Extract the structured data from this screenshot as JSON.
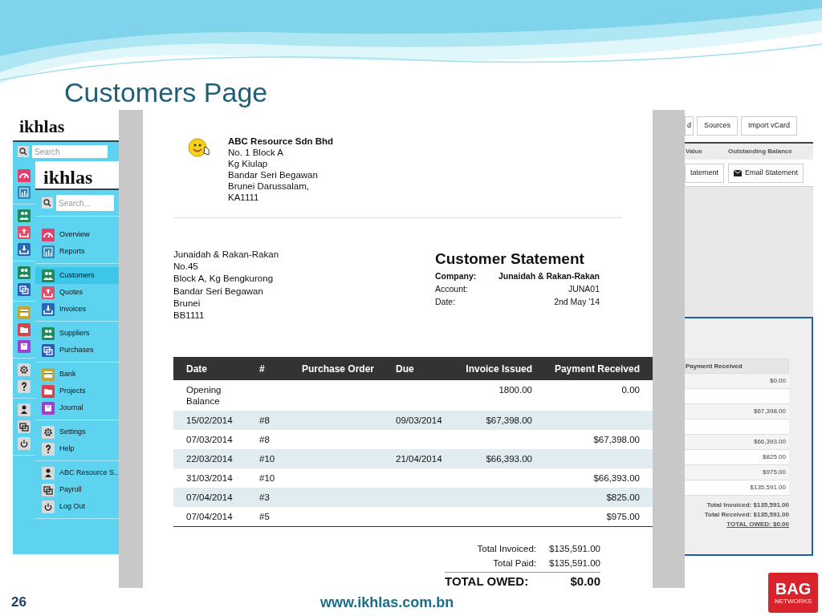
{
  "slide": {
    "title": "Customers Page",
    "page_number": "26",
    "url": "www.ikhlas.com.bn",
    "logo": {
      "text": "BAG",
      "subtext": "NETWORKS"
    }
  },
  "back_app": {
    "logo": "ikhlas",
    "search_placeholder": "Search",
    "icon_groups": [
      [
        {
          "kind": "gauge",
          "color": "#e23f6b"
        },
        {
          "kind": "chart",
          "color": "#2d86b5"
        }
      ],
      [
        {
          "kind": "people",
          "color": "#1f8a5a"
        },
        {
          "kind": "upload",
          "color": "#e0506a"
        },
        {
          "kind": "download",
          "color": "#2a67b5"
        }
      ],
      [
        {
          "kind": "people",
          "color": "#1f8a5a"
        },
        {
          "kind": "cards",
          "color": "#2a5db5"
        }
      ],
      [
        {
          "kind": "card",
          "color": "#c7a533"
        },
        {
          "kind": "folder",
          "color": "#d9434f"
        },
        {
          "kind": "book",
          "color": "#a23fd0"
        }
      ],
      [
        {
          "kind": "gear",
          "color": "#d9d9d9"
        },
        {
          "kind": "question",
          "color": "#d9d9d9"
        }
      ],
      [
        {
          "kind": "person",
          "color": "#d9d9d9"
        },
        {
          "kind": "cards",
          "color": "#d9d9d9"
        },
        {
          "kind": "power",
          "color": "#d9d9d9"
        }
      ]
    ]
  },
  "front_app": {
    "logo": "ikhlas",
    "search_placeholder": "Search...",
    "nav_groups": [
      [
        {
          "label": "Overview",
          "kind": "gauge",
          "color": "#e23f6b",
          "selected": false
        },
        {
          "label": "Reports",
          "kind": "chart",
          "color": "#2d86b5",
          "selected": false
        }
      ],
      [
        {
          "label": "Customers",
          "kind": "people",
          "color": "#1f8a5a",
          "selected": true
        },
        {
          "label": "Quotes",
          "kind": "upload",
          "color": "#e0506a",
          "selected": false
        },
        {
          "label": "Invoices",
          "kind": "download",
          "color": "#2a67b5",
          "selected": false
        }
      ],
      [
        {
          "label": "Suppliers",
          "kind": "people",
          "color": "#1f8a5a",
          "selected": false
        },
        {
          "label": "Purchases",
          "kind": "cards",
          "color": "#2a5db5",
          "selected": false
        }
      ],
      [
        {
          "label": "Bank",
          "kind": "card",
          "color": "#c7a533",
          "selected": false
        },
        {
          "label": "Projects",
          "kind": "folder",
          "color": "#d9434f",
          "selected": false
        },
        {
          "label": "Journal",
          "kind": "book",
          "color": "#a23fd0",
          "selected": false
        }
      ],
      [
        {
          "label": "Settings",
          "kind": "gear",
          "color": "#d9d9d9",
          "selected": false
        },
        {
          "label": "Help",
          "kind": "question",
          "color": "#d9d9d9",
          "selected": false
        }
      ],
      [
        {
          "label": "ABC Resource S...",
          "kind": "person",
          "color": "#d9d9d9",
          "selected": false
        },
        {
          "label": "Payroll",
          "kind": "cards",
          "color": "#d9d9d9",
          "selected": false
        },
        {
          "label": "Log Out",
          "kind": "power",
          "color": "#d9d9d9",
          "selected": false
        }
      ]
    ]
  },
  "statement": {
    "company": {
      "name": "ABC Resource Sdn Bhd",
      "address": [
        "No. 1 Block A",
        "Kg Kiulap",
        "Bandar Seri Begawan",
        "Brunei Darussalam,",
        "KA1111"
      ]
    },
    "customer_address": [
      "Junaidah & Rakan-Rakan",
      "No.45",
      "Block A, Kg Bengkurong",
      "Bandar Seri Begawan",
      "Brunei",
      "BB1111"
    ],
    "title": "Customer Statement",
    "meta": [
      {
        "label": "Company:",
        "value": "Junaidah & Rakan-Rakan",
        "bold": true
      },
      {
        "label": "Account:",
        "value": "JUNA01",
        "bold": false
      },
      {
        "label": "Date:",
        "value": "2nd May '14",
        "bold": false
      }
    ],
    "table": {
      "columns": [
        "Date",
        "#",
        "Purchase Order",
        "Due",
        "Invoice Issued",
        "Payment Received"
      ],
      "rows": [
        {
          "date": "Opening Balance",
          "invoice_issued": "1800.00",
          "payment_received": "0.00"
        },
        {
          "date": "15/02/2014",
          "number": "#8",
          "due": "09/03/2014",
          "invoice_issued": "$67,398.00"
        },
        {
          "date": "07/03/2014",
          "number": "#8",
          "payment_received": "$67,398.00"
        },
        {
          "date": "22/03/2014",
          "number": "#10",
          "due": "21/04/2014",
          "invoice_issued": "$66,393.00"
        },
        {
          "date": "31/03/2014",
          "number": "#10",
          "payment_received": "$66,393.00"
        },
        {
          "date": "07/04/2014",
          "number": "#3",
          "payment_received": "$825.00"
        },
        {
          "date": "07/04/2014",
          "number": "#5",
          "payment_received": "$975.00"
        }
      ]
    },
    "totals": [
      {
        "label": "Total Invoiced:",
        "value": "$135,591.00"
      },
      {
        "label": "Total Paid:",
        "value": "$135,591.00"
      }
    ],
    "total_owed": {
      "label": "TOTAL OWED:",
      "value": "$0.00"
    }
  },
  "right_app": {
    "top_buttons": [
      "d",
      "Sources",
      "Import vCard"
    ],
    "columns": [
      "Value",
      "Outstanding Balance"
    ],
    "row_buttons": [
      {
        "label": "tatement",
        "kind": "plain"
      },
      {
        "label": "Email Statement",
        "kind": "email"
      }
    ],
    "panel": {
      "column": "Payment Received",
      "rows": [
        {
          "value": "$0.00"
        },
        {},
        {
          "value": "$67,398.00"
        },
        {},
        {
          "value": "$66,393.00"
        },
        {
          "value": "$825.00"
        },
        {
          "value": "$975.00"
        },
        {
          "value": "$135,591.00"
        }
      ],
      "totals": [
        "Total Invoiced: $135,591.00",
        "Total Received: $135,591.00"
      ],
      "total_owed": "TOTAL OWED: $0.00"
    }
  }
}
